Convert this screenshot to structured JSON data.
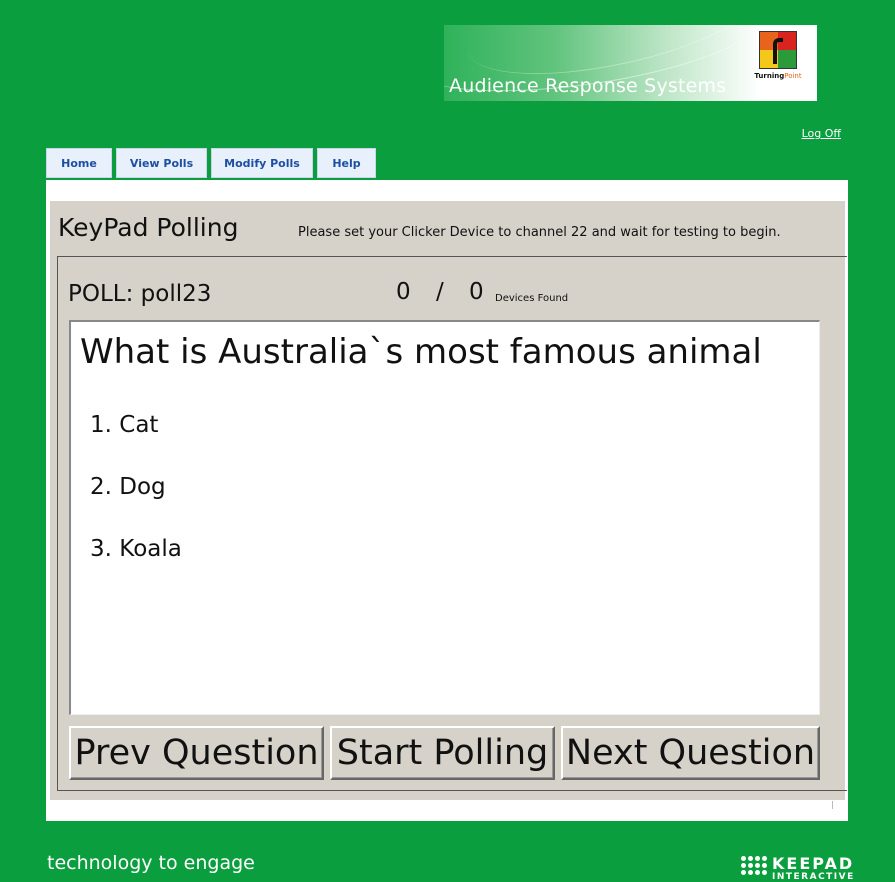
{
  "header": {
    "banner_title": "Audience Response Systems",
    "brand_logo_text_main": "Turning",
    "brand_logo_text_accent": "Point",
    "logoff_label": "Log Off"
  },
  "nav": {
    "tabs": [
      {
        "label": "Home"
      },
      {
        "label": "View Polls"
      },
      {
        "label": "Modify Polls"
      },
      {
        "label": "Help"
      }
    ]
  },
  "main": {
    "title": "KeyPad Polling",
    "instruction": "Please set your Clicker Device to channel 22 and  wait for testing to begin.",
    "poll_name": "POLL: poll23",
    "devices_responded": "0",
    "devices_separator": "/",
    "devices_total": "0",
    "devices_label": "Devices Found",
    "question": "What is Australia`s most famous animal",
    "answers": [
      {
        "label": "1. Cat"
      },
      {
        "label": "2. Dog"
      },
      {
        "label": "3. Koala"
      }
    ],
    "buttons": {
      "prev": "Prev Question",
      "start": "Start Polling",
      "next": "Next Question"
    }
  },
  "footer": {
    "tagline": "technology to engage",
    "brand_main": "KEEPAD",
    "brand_sub": "INTERACTIVE"
  },
  "colors": {
    "page_background": "#0b9e3e",
    "panel_gray": "#d6d2ca",
    "tab_text": "#1d4fa0"
  }
}
